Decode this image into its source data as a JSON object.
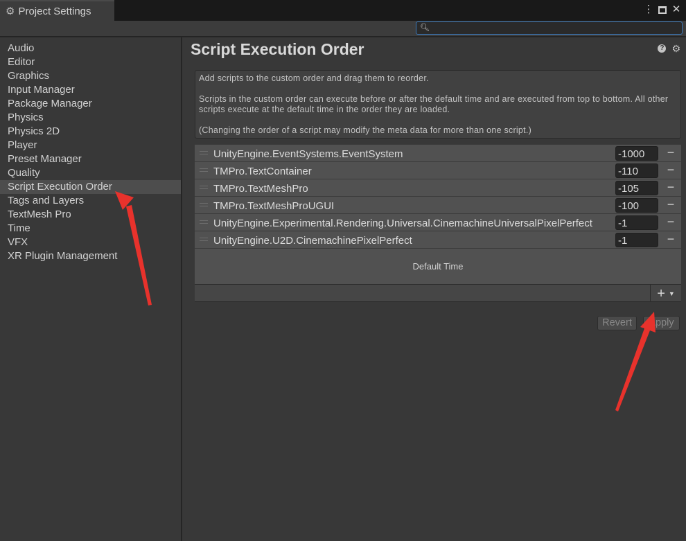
{
  "window": {
    "tab_title": "Project Settings",
    "tab_icon": "gear-icon",
    "controls": [
      "more-menu-icon",
      "maximize-icon",
      "close-icon"
    ]
  },
  "search": {
    "placeholder": "",
    "value": ""
  },
  "sidebar": {
    "items": [
      {
        "label": "Audio"
      },
      {
        "label": "Editor"
      },
      {
        "label": "Graphics"
      },
      {
        "label": "Input Manager"
      },
      {
        "label": "Package Manager"
      },
      {
        "label": "Physics"
      },
      {
        "label": "Physics 2D"
      },
      {
        "label": "Player"
      },
      {
        "label": "Preset Manager"
      },
      {
        "label": "Quality"
      },
      {
        "label": "Script Execution Order",
        "selected": true
      },
      {
        "label": "Tags and Layers"
      },
      {
        "label": "TextMesh Pro"
      },
      {
        "label": "Time"
      },
      {
        "label": "VFX"
      },
      {
        "label": "XR Plugin Management"
      }
    ]
  },
  "main": {
    "title": "Script Execution Order",
    "help_lines": [
      "Add scripts to the custom order and drag them to reorder.",
      "Scripts in the custom order can execute before or after the default time and are executed from top to bottom. All other scripts execute at the default time in the order they are loaded.",
      "(Changing the order of a script may modify the meta data for more than one script.)"
    ],
    "scripts": [
      {
        "name": "UnityEngine.EventSystems.EventSystem",
        "order": "-1000"
      },
      {
        "name": "TMPro.TextContainer",
        "order": "-110"
      },
      {
        "name": "TMPro.TextMeshPro",
        "order": "-105"
      },
      {
        "name": "TMPro.TextMeshProUGUI",
        "order": "-100"
      },
      {
        "name": "UnityEngine.Experimental.Rendering.Universal.CinemachineUniversalPixelPerfect",
        "order": "-1"
      },
      {
        "name": "UnityEngine.U2D.CinemachinePixelPerfect",
        "order": "-1"
      }
    ],
    "default_time_label": "Default Time",
    "revert_label": "Revert",
    "apply_label": "Apply"
  },
  "colors": {
    "background": "#383838",
    "selected_item": "#4d4d4d",
    "row": "#515151",
    "search_border": "#3a79bb",
    "annotation_arrow": "#e8322c"
  }
}
